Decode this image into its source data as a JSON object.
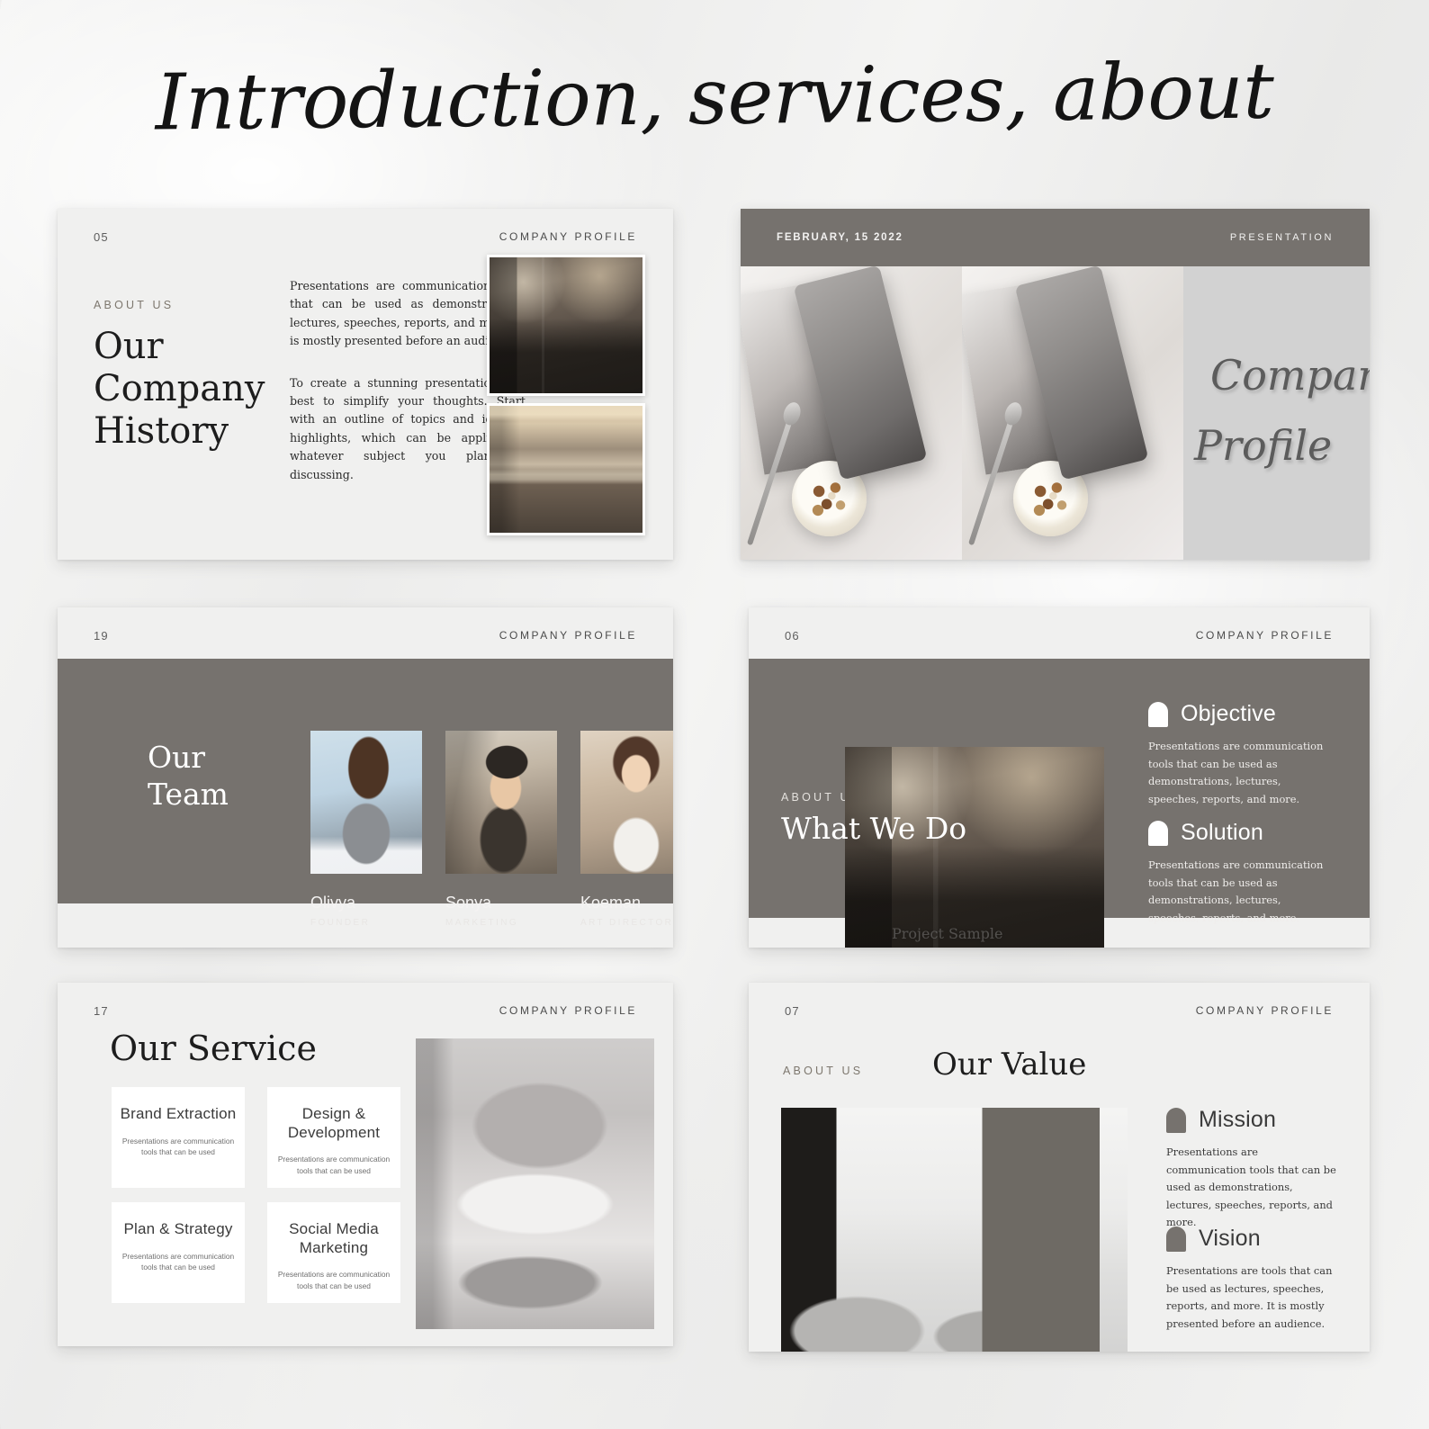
{
  "page": {
    "title": "Introduction, services, about"
  },
  "brand": {
    "kicker": "COMPANY PROFILE",
    "eyebrow": "ABOUT US",
    "accent_gray": "#76726e",
    "slide_bg": "#f0f0ef",
    "card_bg": "#ffffff"
  },
  "slides": [
    {
      "id": "company-history",
      "page_number": "05",
      "kicker": "COMPANY PROFILE",
      "eyebrow": "ABOUT US",
      "title": "Our Company History",
      "paragraphs": [
        "Presentations are communication tools that can be used as demonstrations, lectures, speeches, reports, and more. It is mostly presented before an audience.",
        "To create a stunning presentation, it's best to simplify your thoughts. Start with an outline of topics and identify highlights, which can be applied to whatever subject you plan on discussing."
      ],
      "images": [
        "dark-bedroom-photo",
        "lit-bathroom-photo"
      ]
    },
    {
      "id": "cover",
      "date": "FEBRUARY, 15 2022",
      "kicker_right": "PRESENTATION",
      "script_line1": "Company",
      "script_line2": "Profile",
      "images": [
        "flatlay-tablet-yogurt-photo",
        "flatlay-tablet-yogurt-photo"
      ]
    },
    {
      "id": "our-team",
      "page_number": "19",
      "kicker": "COMPANY PROFILE",
      "title_line1": "Our",
      "title_line2": "Team",
      "members": [
        {
          "name": "Olivya",
          "role": "FOUNDER",
          "photo": "team-portrait-olivya"
        },
        {
          "name": "Sonya",
          "role": "MARKETING",
          "photo": "team-portrait-sonya"
        },
        {
          "name": "Koeman",
          "role": "ART DIRECTOR",
          "photo": "team-portrait-koeman"
        }
      ]
    },
    {
      "id": "what-we-do",
      "page_number": "06",
      "kicker": "COMPANY PROFILE",
      "eyebrow": "ABOUT US",
      "title": "What We Do",
      "image_caption": "Project Sample",
      "image": "dark-bedroom-photo",
      "features": [
        {
          "icon": "arch-icon",
          "title": "Objective",
          "body": "Presentations are communication tools that can be used as demonstrations, lectures, speeches, reports, and more."
        },
        {
          "icon": "arch-icon",
          "title": "Solution",
          "body": "Presentations are communication tools that can be used as demonstrations, lectures, speeches, reports, and more."
        }
      ]
    },
    {
      "id": "our-service",
      "page_number": "17",
      "kicker": "COMPANY PROFILE",
      "title": "Our Service",
      "image": "gray-tufted-bed-photo",
      "cards": [
        {
          "title": "Brand Extraction",
          "desc": "Presentations are communication tools that can be used"
        },
        {
          "title": "Design & Development",
          "desc": "Presentations are communication tools that can be used"
        },
        {
          "title": "Plan & Strategy",
          "desc": "Presentations are communication tools that can be used"
        },
        {
          "title": "Social Media Marketing",
          "desc": "Presentations are communication tools that can be used"
        }
      ]
    },
    {
      "id": "our-value",
      "page_number": "07",
      "kicker": "COMPANY PROFILE",
      "eyebrow": "ABOUT US",
      "title": "Our Value",
      "image": "modern-living-room-photo",
      "features": [
        {
          "icon": "arch-icon",
          "title": "Mission",
          "body": "Presentations are communication tools that can be used as demonstrations, lectures, speeches, reports, and more."
        },
        {
          "icon": "arch-icon",
          "title": "Vision",
          "body": "Presentations are tools that can be used as lectures, speeches, reports, and more. It is mostly presented before an audience."
        }
      ]
    }
  ]
}
